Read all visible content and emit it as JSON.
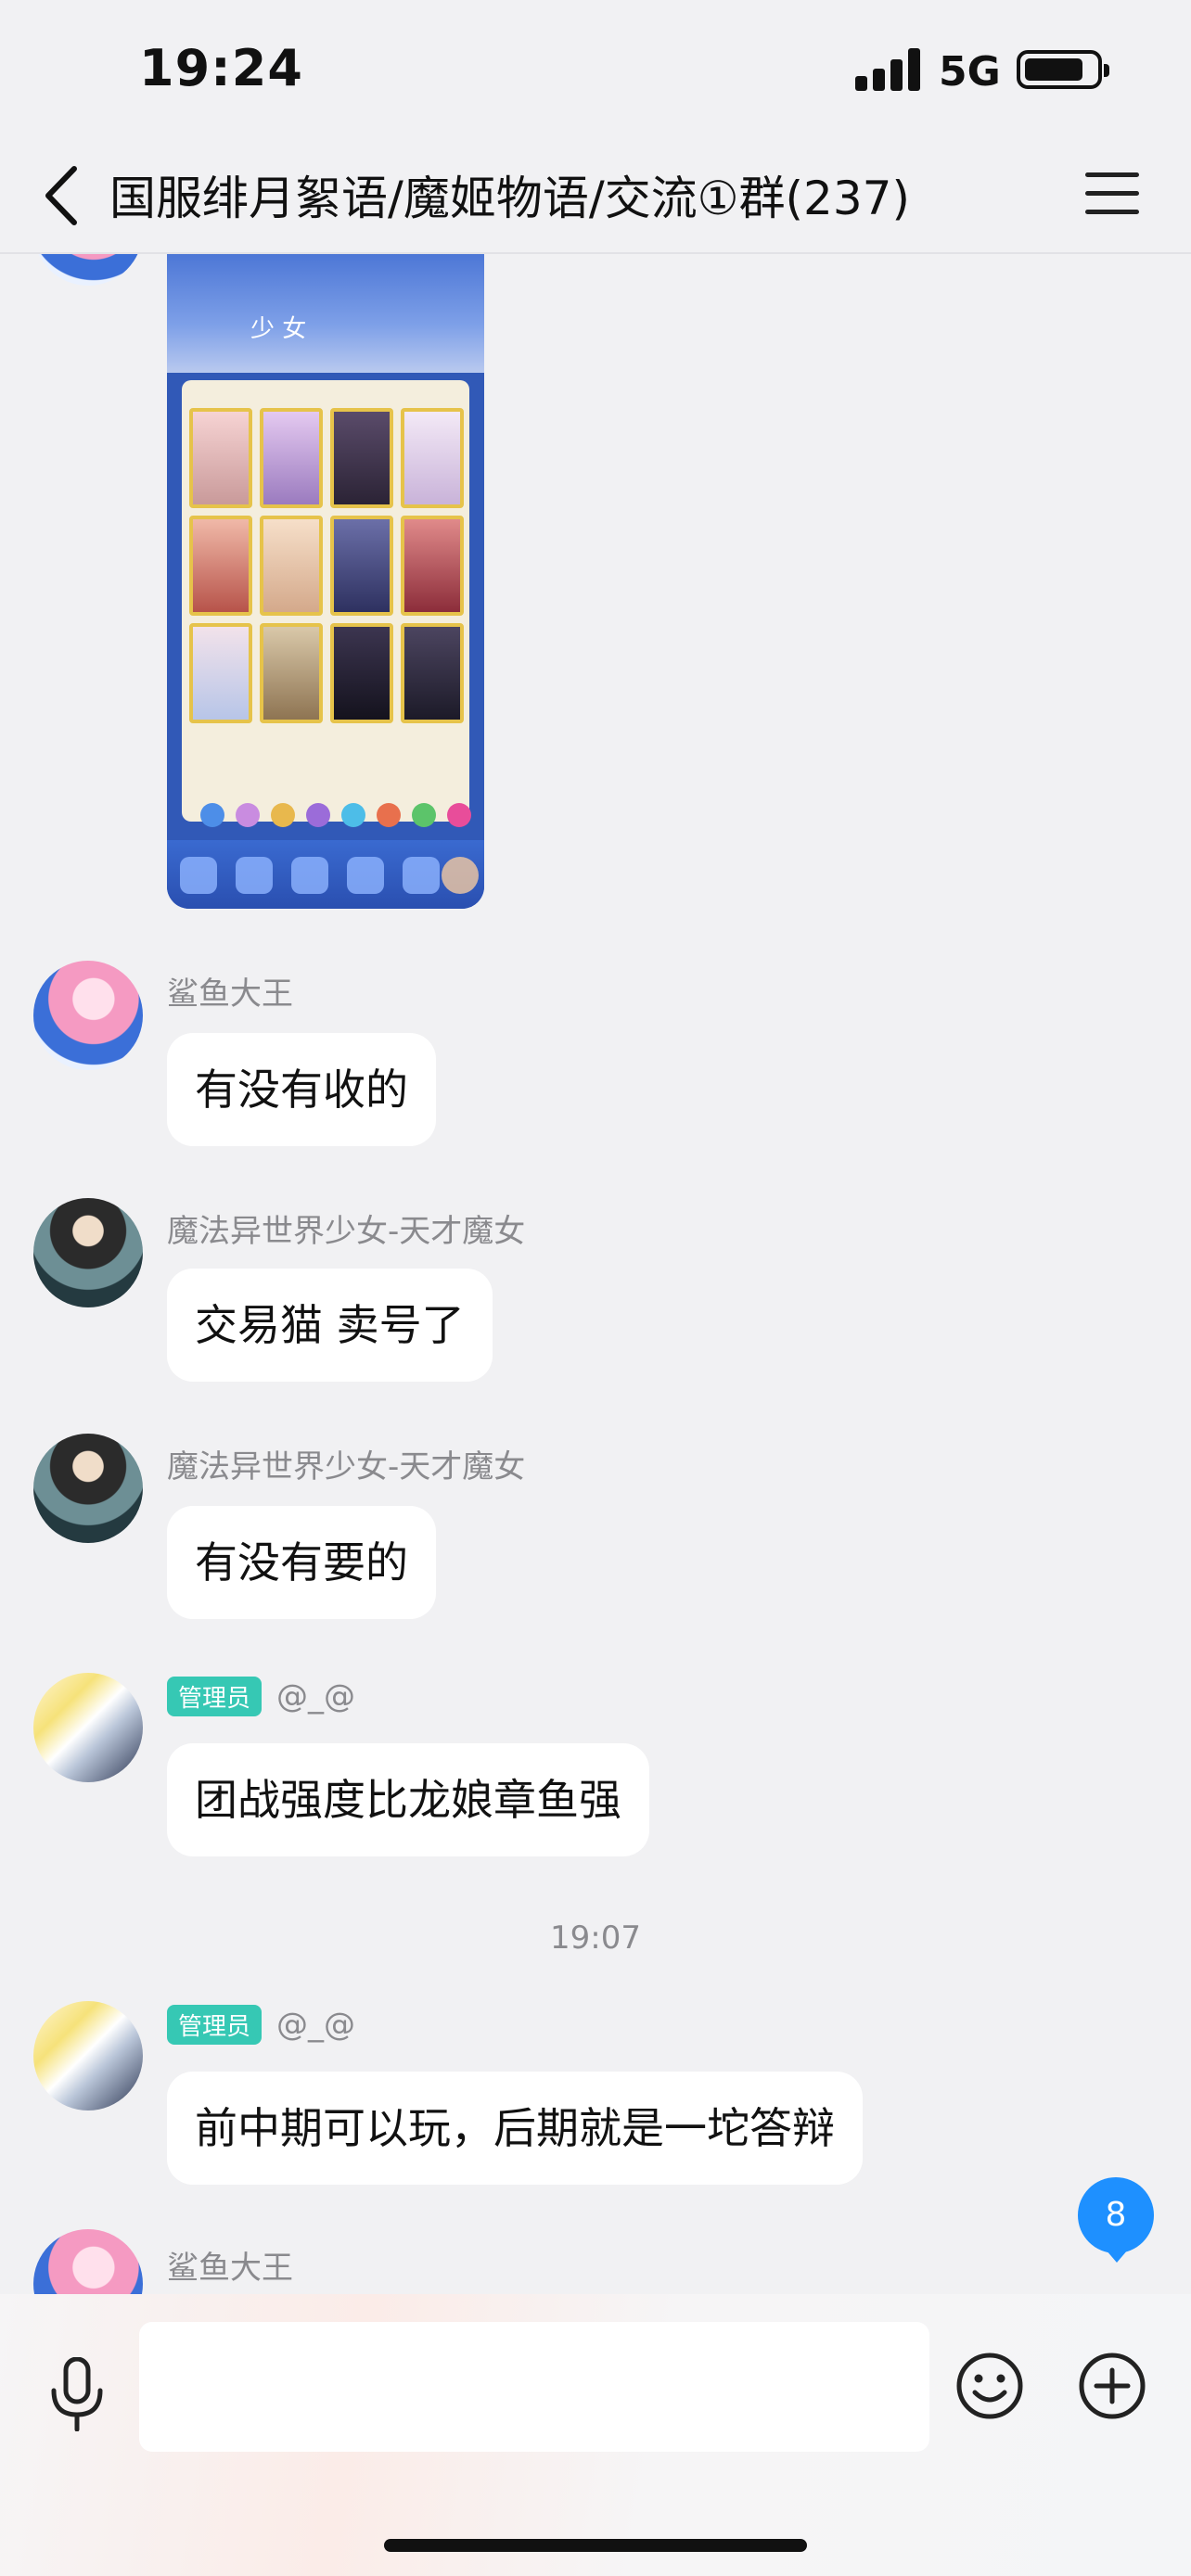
{
  "status_bar": {
    "time": "19:24",
    "network": "5G"
  },
  "header": {
    "title": "国服绯月絮语/魔姬物语/交流①群(237)"
  },
  "shared_image": {
    "banner_text": "少 女"
  },
  "messages": [
    {
      "sender": "鲨鱼大王",
      "role": "",
      "text": "有没有收的",
      "avatar": "pink-hair-avatar"
    },
    {
      "sender": "魔法异世界少女-天才魔女",
      "role": "",
      "text": "交易猫 卖号了",
      "avatar": "dark-avatar"
    },
    {
      "sender": "魔法异世界少女-天才魔女",
      "role": "",
      "text": "有没有要的",
      "avatar": "dark-avatar"
    },
    {
      "sender": "@_@",
      "role": "管理员",
      "text": "团战强度比龙娘章鱼强",
      "avatar": "anime-avatar"
    },
    {
      "timestamp": "19:07"
    },
    {
      "sender": "@_@",
      "role": "管理员",
      "text": "前中期可以玩，后期就是一坨答辩",
      "avatar": "anime-avatar"
    },
    {
      "sender": "鲨鱼大王",
      "role": "",
      "text": "",
      "avatar": "pink-hair-avatar"
    }
  ],
  "unread_count": "8"
}
